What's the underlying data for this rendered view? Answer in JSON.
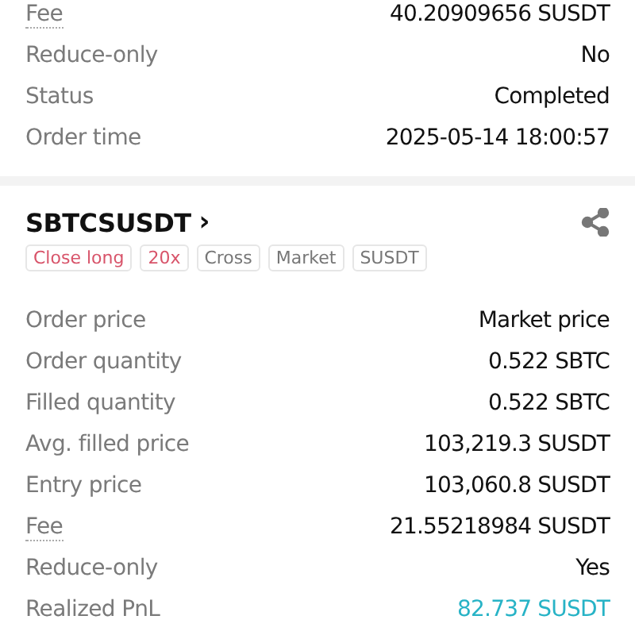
{
  "previous_order": {
    "rows": [
      {
        "label": "Fee",
        "value": "40.20909656 SUSDT",
        "underlined": true,
        "profit": false
      },
      {
        "label": "Reduce-only",
        "value": "No",
        "underlined": false,
        "profit": false
      },
      {
        "label": "Status",
        "value": "Completed",
        "underlined": false,
        "profit": false
      },
      {
        "label": "Order time",
        "value": "2025-05-14 18:00:57",
        "underlined": false,
        "profit": false
      }
    ]
  },
  "order": {
    "symbol": "SBTCSUSDT",
    "chevron": "›",
    "tags": [
      {
        "label": "Close long",
        "accent": true
      },
      {
        "label": "20x",
        "accent": true
      },
      {
        "label": "Cross",
        "accent": false
      },
      {
        "label": "Market",
        "accent": false
      },
      {
        "label": "SUSDT",
        "accent": false
      }
    ],
    "rows": [
      {
        "label": "Order price",
        "value": "Market price",
        "underlined": false,
        "profit": false
      },
      {
        "label": "Order quantity",
        "value": "0.522 SBTC",
        "underlined": false,
        "profit": false
      },
      {
        "label": "Filled quantity",
        "value": "0.522 SBTC",
        "underlined": false,
        "profit": false
      },
      {
        "label": "Avg. filled price",
        "value": "103,219.3 SUSDT",
        "underlined": false,
        "profit": false
      },
      {
        "label": "Entry price",
        "value": "103,060.8 SUSDT",
        "underlined": false,
        "profit": false
      },
      {
        "label": "Fee",
        "value": "21.55218984 SUSDT",
        "underlined": true,
        "profit": false
      },
      {
        "label": "Reduce-only",
        "value": "Yes",
        "underlined": false,
        "profit": false
      },
      {
        "label": "Realized PnL",
        "value": "82.737 SUSDT",
        "underlined": false,
        "profit": true
      }
    ]
  }
}
